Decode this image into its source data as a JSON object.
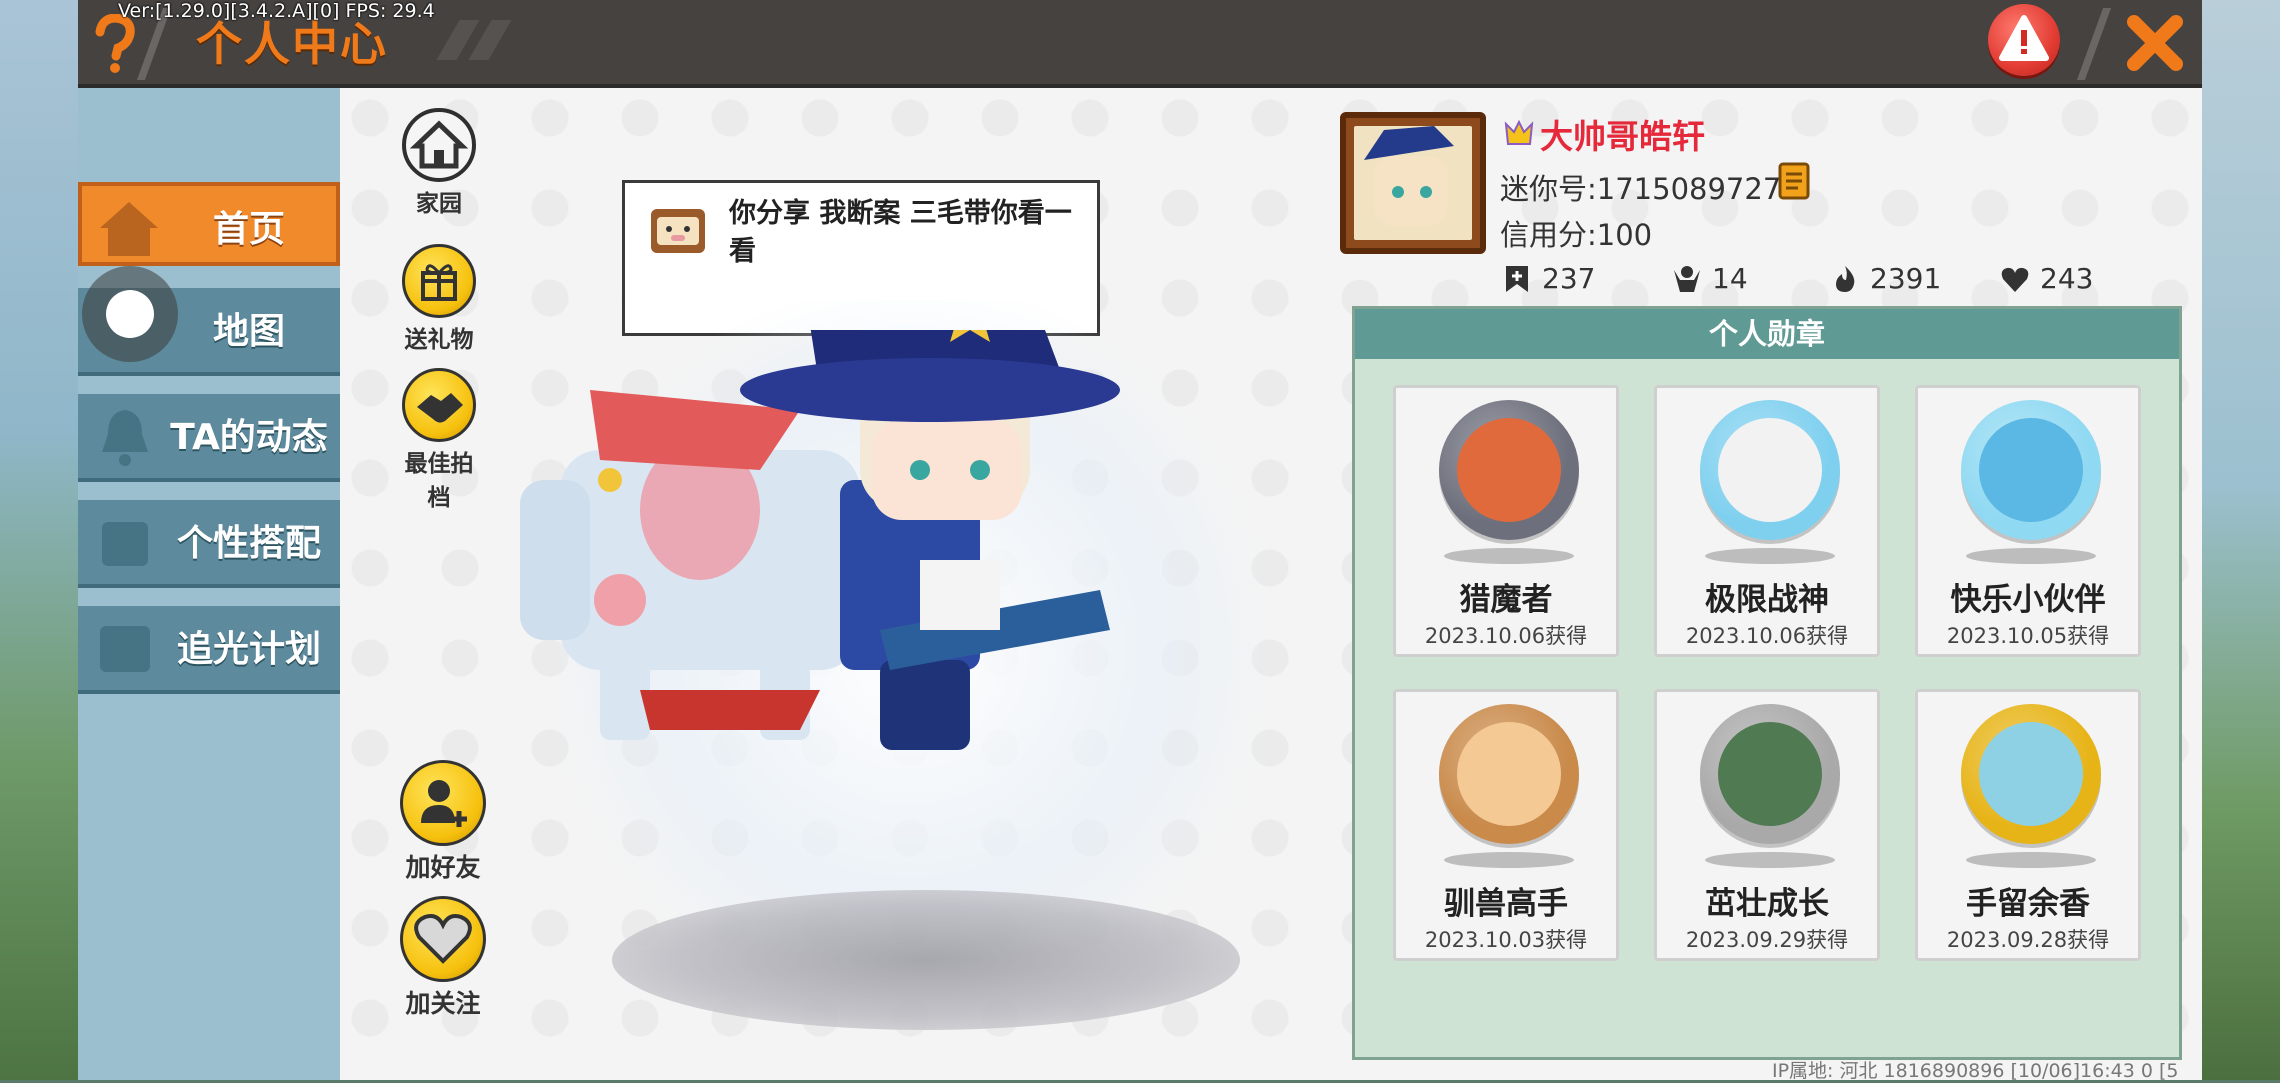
{
  "debug": {
    "version_text": "Ver:[1.29.0][3.4.2.A][0] FPS: 29.4"
  },
  "header": {
    "title": "个人中心",
    "help_icon": "question-mark-icon",
    "warning_icon": "warning-icon",
    "close_icon": "close-x-icon"
  },
  "nav": {
    "items": [
      {
        "label": "首页",
        "icon": "house-icon",
        "active": true
      },
      {
        "label": "地图",
        "icon": "map-icon",
        "active": false
      },
      {
        "label": "TA的动态",
        "icon": "bell-icon",
        "active": false
      },
      {
        "label": "个性搭配",
        "icon": "outfit-icon",
        "active": false
      },
      {
        "label": "追光计划",
        "icon": "light-plan-icon",
        "active": false
      }
    ]
  },
  "actions": {
    "home": "家园",
    "gift": "送礼物",
    "partner": "最佳拍档",
    "add_friend": "加好友",
    "follow": "加关注"
  },
  "bubble": {
    "text": "你分享  我断案  三毛带你看一看"
  },
  "profile": {
    "name": "大帅哥皓轩",
    "mini_id": "迷你号:1715089727",
    "credit": "信用分:100",
    "stats": [
      {
        "icon": "bookmark-plus-icon",
        "value": "237"
      },
      {
        "icon": "trophy-person-icon",
        "value": "14"
      },
      {
        "icon": "flame-icon",
        "value": "2391"
      },
      {
        "icon": "heart-icon",
        "value": "243"
      }
    ]
  },
  "badges": {
    "title": "个人勋章",
    "items": [
      {
        "name": "猎魔者",
        "date": "2023.10.06获得",
        "ring": "#6d6f7c",
        "core": "#e06a3c"
      },
      {
        "name": "极限战神",
        "date": "2023.10.06获得",
        "ring": "#7fd0ef",
        "core": "#f2f2f2"
      },
      {
        "name": "快乐小伙伴",
        "date": "2023.10.05获得",
        "ring": "#8fd9f2",
        "core": "#5bb7e3"
      },
      {
        "name": "驯兽高手",
        "date": "2023.10.03获得",
        "ring": "#c98a4a",
        "core": "#f4c993"
      },
      {
        "name": "茁壮成长",
        "date": "2023.09.29获得",
        "ring": "#a9a9a9",
        "core": "#4f7a52"
      },
      {
        "name": "手留余香",
        "date": "2023.09.28获得",
        "ring": "#e7b417",
        "core": "#8ed0e4"
      }
    ]
  },
  "footer": {
    "text": "IP属地: 河北        1816890896   [10/06]16:43 0   [5"
  }
}
